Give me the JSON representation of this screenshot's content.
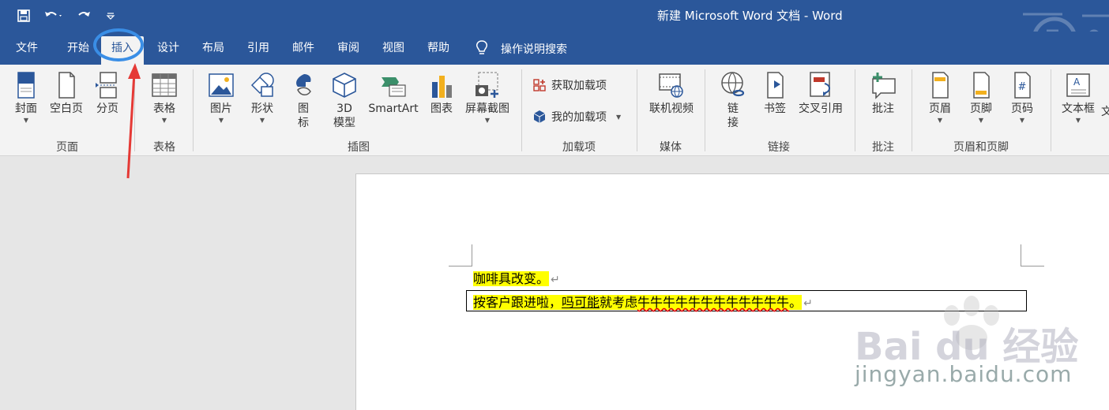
{
  "window": {
    "title": "新建 Microsoft Word 文档  -  Word"
  },
  "tabs": [
    {
      "label": "文件"
    },
    {
      "label": "开始"
    },
    {
      "label": "插入"
    },
    {
      "label": "设计"
    },
    {
      "label": "布局"
    },
    {
      "label": "引用"
    },
    {
      "label": "邮件"
    },
    {
      "label": "审阅"
    },
    {
      "label": "视图"
    },
    {
      "label": "帮助"
    }
  ],
  "tellme": {
    "label": "操作说明搜索"
  },
  "ribbon": {
    "cover": "封面",
    "blank": "空白页",
    "pagebreak": "分页",
    "group_pages": "页面",
    "table": "表格",
    "group_table": "表格",
    "picture": "图片",
    "shapes": "形状",
    "icons_line1": "图",
    "icons_line2": "标",
    "model_line1": "3D",
    "model_line2": "模型",
    "smartart": "SmartArt",
    "chart": "图表",
    "screenshot": "屏幕截图",
    "group_illustrations": "插图",
    "get_addins": "获取加载项",
    "my_addins": "我的加载项",
    "group_addins": "加载项",
    "online_video": "联机视频",
    "group_media": "媒体",
    "link_line1": "链",
    "link_line2": "接",
    "bookmark": "书签",
    "crossref": "交叉引用",
    "group_links": "链接",
    "comment": "批注",
    "group_comments": "批注",
    "header": "页眉",
    "footer": "页脚",
    "pagenum": "页码",
    "group_headerfooter": "页眉和页脚",
    "textbox": "文本框",
    "textbox_cut": "文"
  },
  "document": {
    "line1": "咖啡具改变。",
    "line2_a": "按客户跟进啦，",
    "line2_b": "吗可能",
    "line2_c": "就考虑",
    "line2_d": "牛牛牛牛牛牛牛牛牛牛牛牛",
    "line2_e": "。",
    "para_mark": "↵"
  },
  "watermark": {
    "text": "jingyan.baidu.com",
    "brand": "Bai du 经验"
  }
}
